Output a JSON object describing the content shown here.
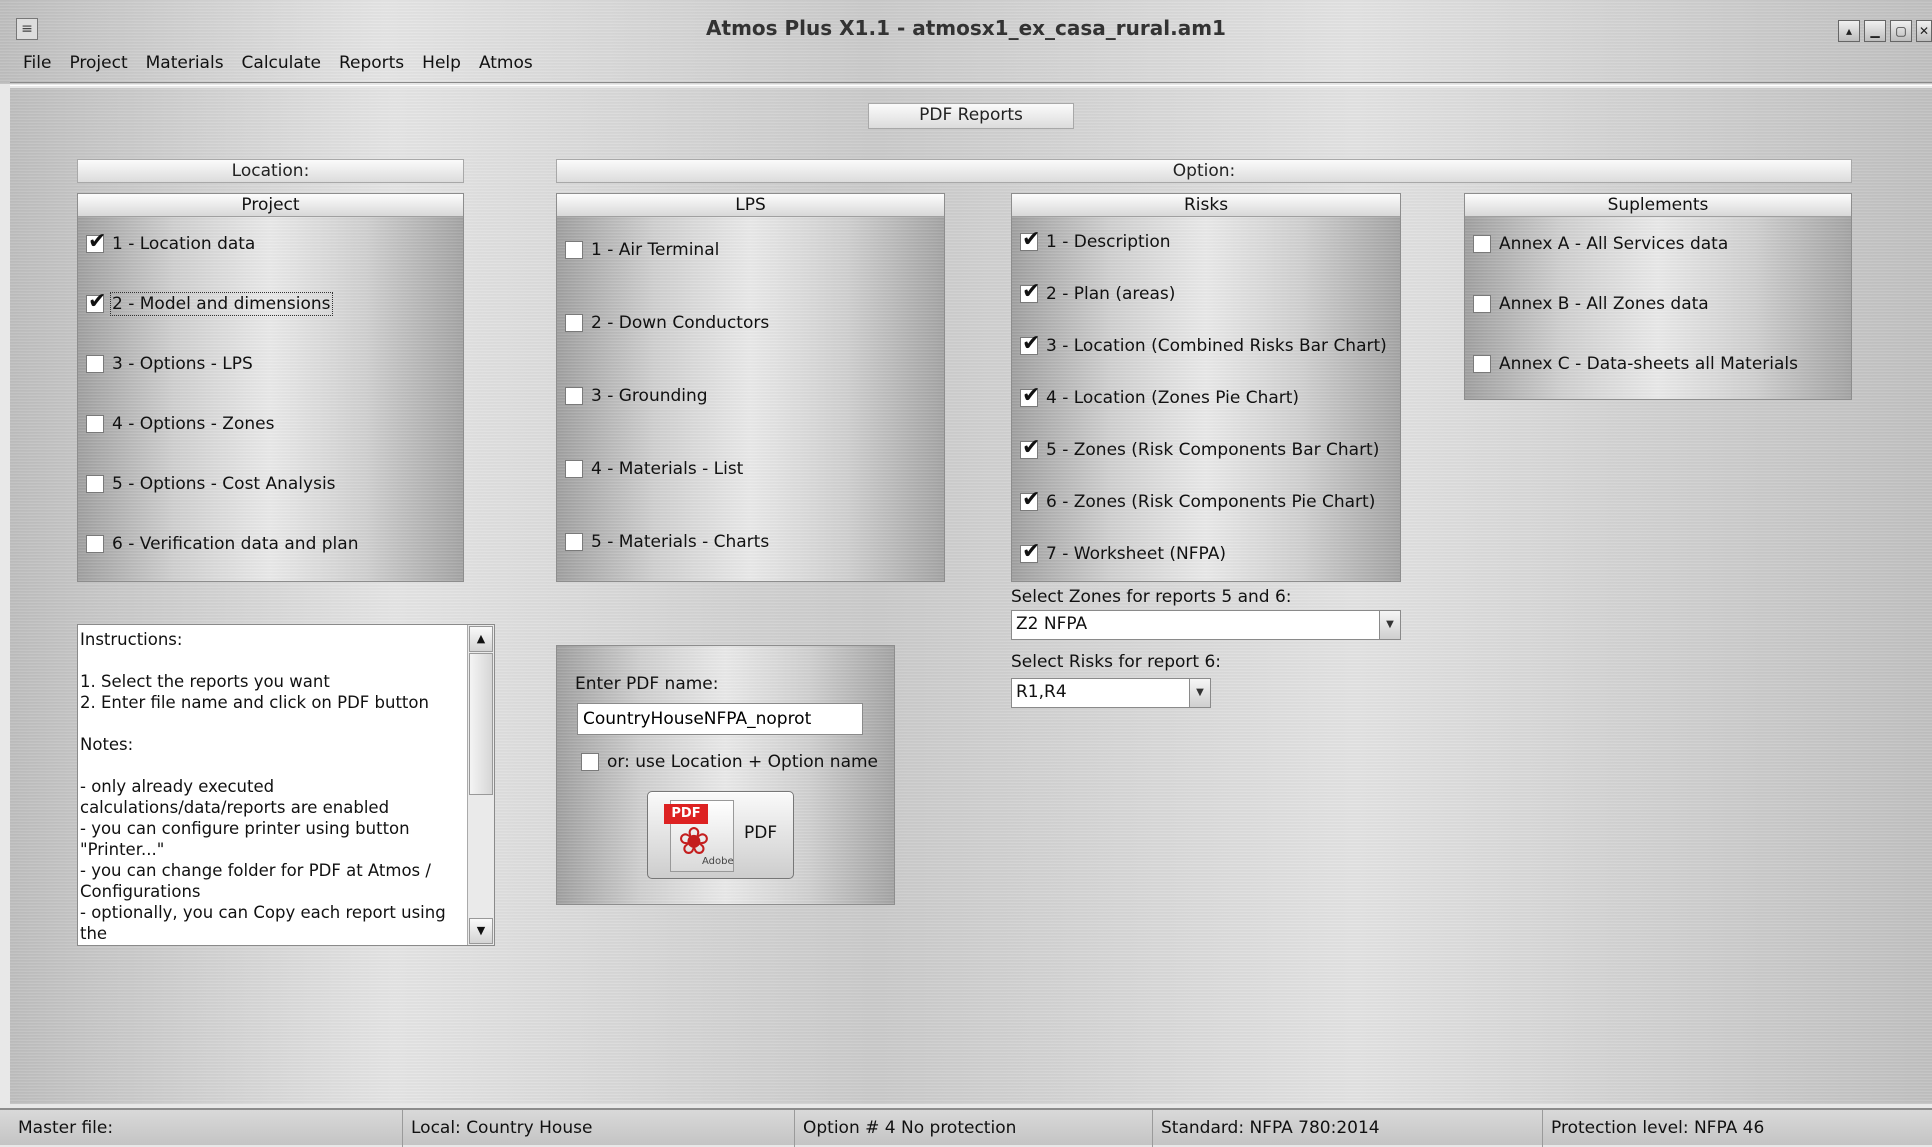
{
  "window": {
    "title": "Atmos Plus X1.1 - atmosx1_ex_casa_rural.am1",
    "controls": [
      "restore-up-icon",
      "minimize-icon",
      "maximize-icon",
      "close-icon"
    ]
  },
  "menu": [
    "File",
    "Project",
    "Materials",
    "Calculate",
    "Reports",
    "Help",
    "Atmos"
  ],
  "header": {
    "label": "PDF Reports"
  },
  "location_label": "Location:",
  "option_label": "Option:",
  "project_panel": {
    "title": "Project",
    "items": [
      {
        "label": "1 - Location data",
        "checked": true
      },
      {
        "label": "2 - Model and dimensions",
        "checked": true,
        "focused": true
      },
      {
        "label": "3 - Options - LPS",
        "checked": false
      },
      {
        "label": "4 - Options - Zones",
        "checked": false
      },
      {
        "label": "5 - Options - Cost Analysis",
        "checked": false
      },
      {
        "label": "6 - Verification data and plan",
        "checked": false
      }
    ]
  },
  "lps_panel": {
    "title": "LPS",
    "items": [
      {
        "label": "1 - Air Terminal",
        "checked": false
      },
      {
        "label": "2 - Down Conductors",
        "checked": false
      },
      {
        "label": "3 - Grounding",
        "checked": false
      },
      {
        "label": "4 - Materials - List",
        "checked": false
      },
      {
        "label": "5 - Materials - Charts",
        "checked": false
      }
    ]
  },
  "risks_panel": {
    "title": "Risks",
    "items": [
      {
        "label": "1 - Description",
        "checked": true
      },
      {
        "label": "2 - Plan (areas)",
        "checked": true
      },
      {
        "label": "3 - Location (Combined Risks Bar Chart)",
        "checked": true
      },
      {
        "label": "4 - Location (Zones Pie Chart)",
        "checked": true
      },
      {
        "label": "5 - Zones (Risk Components Bar Chart)",
        "checked": true
      },
      {
        "label": "6 - Zones (Risk Components Pie Chart)",
        "checked": true
      },
      {
        "label": "7 - Worksheet (NFPA)",
        "checked": true
      }
    ]
  },
  "supplements_panel": {
    "title": "Suplements",
    "items": [
      {
        "label": "Annex A - All Services data",
        "checked": false
      },
      {
        "label": "Annex B - All Zones data",
        "checked": false
      },
      {
        "label": "Annex C - Data-sheets all Materials",
        "checked": false
      }
    ]
  },
  "zones_select": {
    "label": "Select Zones for reports 5 and 6:",
    "value": "Z2 NFPA"
  },
  "risks_select": {
    "label": "Select Risks for report 6:",
    "value": "R1,R4"
  },
  "instructions": {
    "lines": [
      "Instructions:",
      "",
      "1. Select the reports you want",
      "2. Enter file name and click on PDF button",
      "",
      "Notes:",
      "",
      "- only already executed calculations/data/reports are enabled",
      "- you can configure printer using button \"Printer...\"",
      "- you can change folder for PDF at Atmos / Configurations",
      "- optionally, you can Copy each report using the"
    ]
  },
  "pdf_box": {
    "label": "Enter PDF name:",
    "value": "CountryHouseNFPA_noprot",
    "use_option_label": "or: use Location + Option name",
    "use_option_checked": false,
    "button_label": "PDF",
    "icon_text": "PDF",
    "icon_brand": "Adobe"
  },
  "status": [
    "Master file:",
    "Local: Country House",
    "Option # 4 No protection",
    "Standard: NFPA 780:2014",
    "Protection level: NFPA 46"
  ]
}
